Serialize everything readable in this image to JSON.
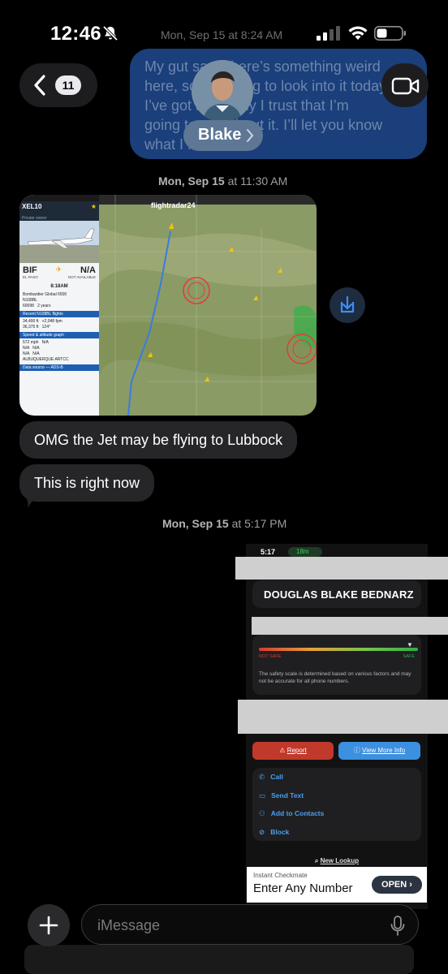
{
  "status_bar": {
    "time": "12:46",
    "date": "Mon, Sep 15 at 8:24 AM"
  },
  "nav": {
    "back_count": "11"
  },
  "contact": {
    "name": "Blake"
  },
  "outgoing_message": {
    "lines": [
      "My gut says there’s something weird",
      "here, so I’m going to look into it today",
      "I’ve got an IT guy I trust that I’m",
      "going to ask about it. I’ll let you know",
      "what I find out"
    ]
  },
  "timestamps": [
    {
      "day": "Mon, Sep 15",
      "time": "at 11:30 AM"
    },
    {
      "day": "Mon, Sep 15",
      "time": "at 5:17 PM"
    }
  ],
  "flight_screenshot": {
    "flight": "XEL10",
    "airline": "Private owner",
    "brand": "flightradar24",
    "origin_code": "BIF",
    "origin_city": "EL PASO",
    "dest_code": "N/A",
    "dest_label": "NOT AVAILABLE",
    "time": "8:18AM",
    "aircraft_type": "Bombardier Global 6500",
    "registration": "N108BL",
    "serial": "60098",
    "age": "2 years",
    "recent": "Recent N108BL flights",
    "baro_alt": "34,400 ft",
    "vert_speed": "+2,048 fpm",
    "gps_alt": "36,375 ft",
    "track": "124°",
    "section_speed": "Speed & altitude graph",
    "ground_speed": "572 mph",
    "true_airspeed": "N/A",
    "indicated_airspeed": "N/A",
    "mach": "N/A",
    "wind": "N/A",
    "temp": "N/A",
    "fir": "ALBUQUERQUE ARTCC",
    "data_source": "Data source — ADS-B"
  },
  "incoming_messages": [
    {
      "text": "OMG the Jet may be flying to Lubbock"
    },
    {
      "text": "This is right now"
    }
  ],
  "lookup_screenshot": {
    "time": "5:17",
    "call_timer": "18m",
    "person_name": "DOUGLAS BLAKE BEDNARZ",
    "not_safe": "NOT SAFE",
    "safe": "SAFE",
    "disclaimer": "The safety scale is determined based on various factors and may not be accurate for all phone numbers.",
    "report_label": "Report",
    "view_more_label": "View More Info",
    "menu": [
      "Call",
      "Send Text",
      "Add to Contacts",
      "Block"
    ],
    "new_lookup": "New Lookup",
    "ad_small": "Instant Checkmate",
    "ad_big": "Enter Any Number",
    "ad_button": "OPEN"
  },
  "composer": {
    "placeholder": "iMessage"
  },
  "colors": {
    "blue_bubble": "#1a3f7a",
    "grey_bubble": "#262628",
    "accent": "#0a84ff"
  }
}
